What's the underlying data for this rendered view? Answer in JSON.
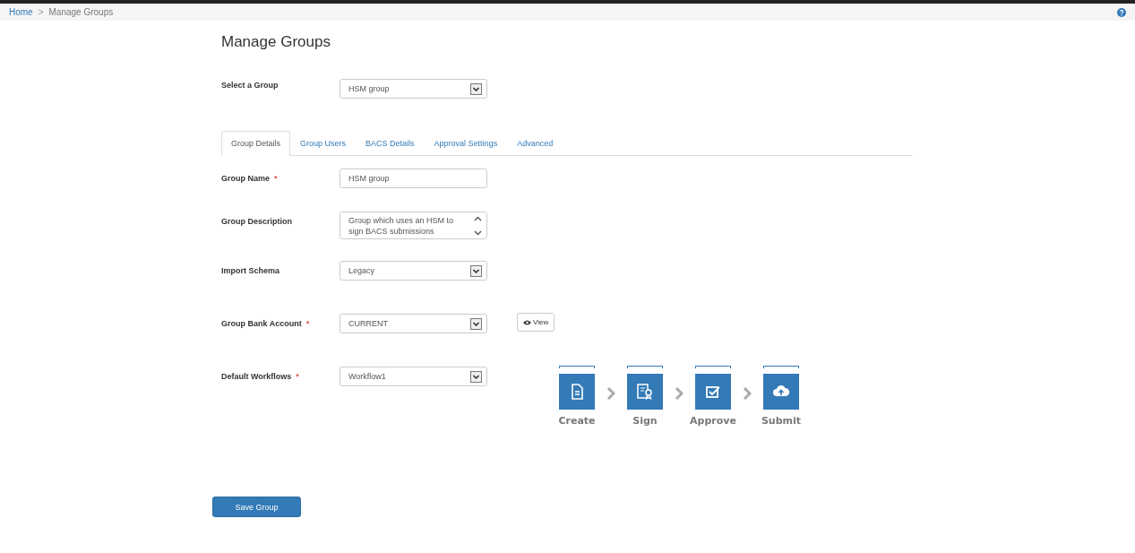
{
  "breadcrumb": [
    {
      "label": "Home",
      "kind": "link"
    },
    {
      "label": "Manage Groups",
      "kind": "current",
      "separator": ">"
    }
  ],
  "page_title": "Manage Groups",
  "group_selector": {
    "label": "Select a Group",
    "value": "HSM group"
  },
  "tabs": [
    {
      "label": "Group Details",
      "selected": true
    },
    {
      "label": "Group Users",
      "selected": false
    },
    {
      "label": "BACS Details",
      "selected": false
    },
    {
      "label": "Approval Settings",
      "selected": false
    },
    {
      "label": "Advanced",
      "selected": false
    }
  ],
  "fields": [
    {
      "label": "Group Name",
      "required_mark": "*",
      "kind": "text",
      "value": "HSM group"
    },
    {
      "label": "Group Description",
      "kind": "textarea",
      "value": "Group which uses an HSM to sign BACS submissions"
    },
    {
      "label": "Import Schema",
      "kind": "select",
      "value": "Legacy"
    },
    {
      "label": "Group Bank Account",
      "required_mark": "*",
      "kind": "select",
      "value": "CURRENT",
      "button": "View"
    },
    {
      "label": "Default Workflows",
      "required_mark": "*",
      "kind": "select",
      "value": "Workflow1"
    }
  ],
  "workflow_steps": [
    {
      "label": "Create",
      "kind": "document"
    },
    {
      "label": "Sign",
      "kind": "certificate"
    },
    {
      "label": "Approve",
      "kind": "check"
    },
    {
      "label": "Submit",
      "kind": "upload"
    }
  ],
  "save_button": "Save Group"
}
